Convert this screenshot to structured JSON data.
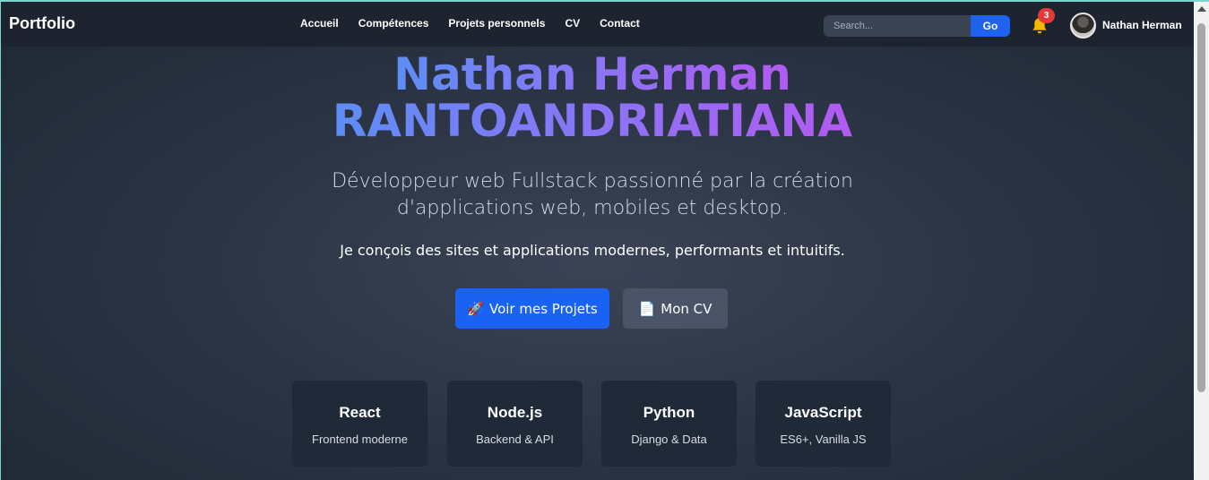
{
  "navbar": {
    "brand": "Portfolio",
    "links": [
      "Accueil",
      "Compétences",
      "Projets personnels",
      "CV",
      "Contact"
    ],
    "search_placeholder": "Search...",
    "search_button": "Go",
    "notification_count": "3",
    "user_name": "Nathan Herman"
  },
  "hero": {
    "name_line1": "Nathan Herman",
    "name_line2": "RANTOANDRIATIANA",
    "subtitle": "Développeur web Fullstack passionné par la création d'applications web, mobiles et desktop.",
    "tagline": "Je conçois des sites et applications modernes, performants et intuitifs.",
    "primary_button": {
      "icon": "🚀",
      "label": "Voir mes Projets"
    },
    "secondary_button": {
      "icon": "📄",
      "label": "Mon CV"
    }
  },
  "skills": [
    {
      "title": "React",
      "desc": "Frontend moderne"
    },
    {
      "title": "Node.js",
      "desc": "Backend & API"
    },
    {
      "title": "Python",
      "desc": "Django & Data"
    },
    {
      "title": "JavaScript",
      "desc": "ES6+, Vanilla JS"
    }
  ],
  "colors": {
    "accent": "#1a62f2",
    "gradient_start": "#5d8ef5",
    "gradient_end": "#b35af2",
    "badge": "#e53838",
    "bell": "#f5b800"
  }
}
